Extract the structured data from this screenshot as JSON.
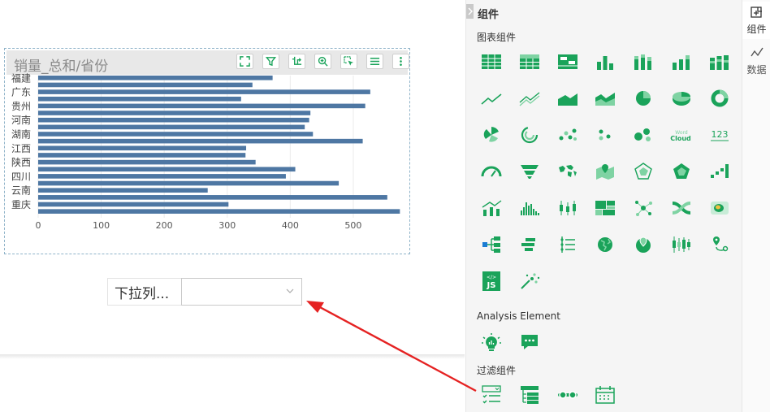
{
  "chart": {
    "title": "销量_总和/省份",
    "toolbar_icons": [
      "fullscreen-icon",
      "filter-icon",
      "sort-icon",
      "zoom-icon",
      "select-icon",
      "list-icon",
      "more-icon"
    ]
  },
  "chart_data": {
    "type": "bar",
    "orientation": "horizontal",
    "title": "销量_总和/省份",
    "categories": [
      "福建",
      "",
      "广东",
      "",
      "贵州",
      "",
      "河南",
      "",
      "湖南",
      "",
      "江西",
      "",
      "陕西",
      "",
      "四川",
      "",
      "云南",
      "",
      "重庆"
    ],
    "values": [
      372,
      340,
      527,
      322,
      519,
      432,
      430,
      423,
      436,
      515,
      330,
      329,
      345,
      408,
      393,
      477,
      269,
      554,
      302,
      574
    ],
    "xlim": [
      0,
      580
    ],
    "xticks": [
      "0",
      "100",
      "200",
      "300",
      "400",
      "500"
    ],
    "grid": true,
    "color": "#4e77a3"
  },
  "filter": {
    "label": "下拉列...",
    "value": ""
  },
  "panel": {
    "title": "组件",
    "sections": {
      "charts": "图表组件",
      "analysis": "Analysis Element",
      "filters": "过滤组件"
    },
    "accent": "#1aa35a"
  },
  "tabs": [
    {
      "label": "组件"
    },
    {
      "label": "数据"
    }
  ]
}
